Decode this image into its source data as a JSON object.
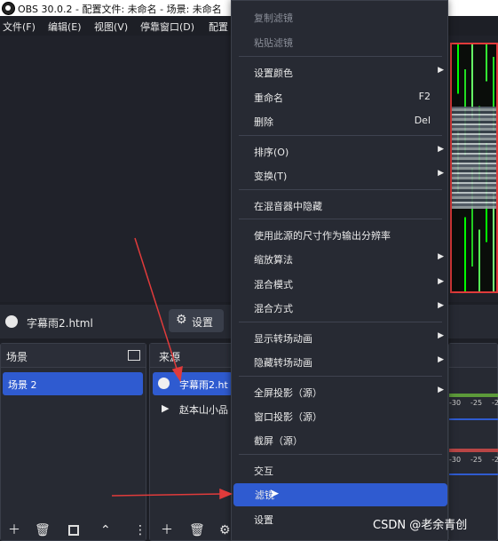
{
  "window": {
    "title": "OBS 30.0.2 - 配置文件: 未命名 - 场景: 未命名"
  },
  "menubar": {
    "items": [
      "文件(F)",
      "编辑(E)",
      "视图(V)",
      "停靠窗口(D)",
      "配置"
    ]
  },
  "source_bar": {
    "source_name": "字幕雨2.html",
    "settings_label": "设置"
  },
  "scenes_dock": {
    "title": "场景",
    "items": [
      "场景 2"
    ]
  },
  "sources_dock": {
    "title": "来源",
    "items": [
      "字幕雨2.ht",
      "赵本山小品"
    ]
  },
  "mixer": {
    "ticks": [
      "-30",
      "-25",
      "-2"
    ]
  },
  "context_menu": {
    "items": [
      {
        "label": "复制滤镜",
        "disabled": true
      },
      {
        "label": "粘贴滤镜",
        "disabled": true
      },
      {
        "label": "设置颜色",
        "submenu": true
      },
      {
        "label": "重命名",
        "shortcut": "F2"
      },
      {
        "label": "删除",
        "shortcut": "Del"
      },
      {
        "label": "排序(O)",
        "submenu": true
      },
      {
        "label": "变换(T)",
        "submenu": true
      },
      {
        "label": "在混音器中隐藏"
      },
      {
        "label": "使用此源的尺寸作为输出分辨率"
      },
      {
        "label": "缩放算法",
        "submenu": true
      },
      {
        "label": "混合模式",
        "submenu": true
      },
      {
        "label": "混合方式",
        "submenu": true
      },
      {
        "label": "显示转场动画",
        "submenu": true
      },
      {
        "label": "隐藏转场动画",
        "submenu": true
      },
      {
        "label": "全屏投影（源）",
        "submenu": true
      },
      {
        "label": "窗口投影（源）"
      },
      {
        "label": "截屏（源）"
      },
      {
        "label": "交互"
      },
      {
        "label": "滤镜",
        "highlighted": true
      },
      {
        "label": "设置"
      }
    ]
  },
  "watermark": "CSDN @老余青创",
  "colors": {
    "accent": "#2f5bd0",
    "annotation_arrow": "#e03b3b",
    "background": "#1d1f26"
  },
  "icons": [
    "obs-logo-icon",
    "globe-icon",
    "gear-icon",
    "submenu-arrow-icon",
    "play-icon",
    "add-icon",
    "trash-icon",
    "filter-icon",
    "up-icon",
    "more-icon",
    "popout-icon",
    "mouse-cursor-icon"
  ]
}
